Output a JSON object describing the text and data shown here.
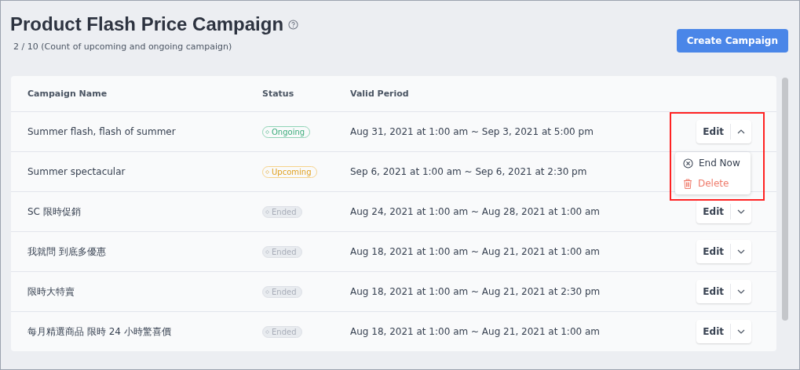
{
  "title": "Product Flash Price Campaign",
  "count_text": "2 / 10 (Count of upcoming and ongoing campaign)",
  "create_button": "Create Campaign",
  "columns": [
    "Campaign Name",
    "Status",
    "Valid Period"
  ],
  "rows": [
    {
      "name": "Summer flash, flash of summer",
      "status": {
        "kind": "ongoing",
        "label": "Ongoing"
      },
      "period": "Aug 31, 2021 at 1:00 am ~ Sep 3, 2021 at 5:00 pm",
      "edit": "Edit",
      "expanded": true
    },
    {
      "name": "Summer spectacular",
      "status": {
        "kind": "upcoming",
        "label": "Upcoming"
      },
      "period": "Sep 6, 2021 at 1:00 am ~ Sep 6, 2021 at 2:30 pm"
    },
    {
      "name": "SC 限時促銷",
      "status": {
        "kind": "ended",
        "label": "Ended"
      },
      "period": "Aug 24, 2021 at 1:00 am ~ Aug 28, 2021 at 1:00 am",
      "edit": "Edit",
      "expanded": false
    },
    {
      "name": "我就問 到底多優惠",
      "status": {
        "kind": "ended",
        "label": "Ended"
      },
      "period": "Aug 18, 2021 at 1:00 am ~ Aug 21, 2021 at 1:00 am",
      "edit": "Edit",
      "expanded": false
    },
    {
      "name": "限時大特賣",
      "status": {
        "kind": "ended",
        "label": "Ended"
      },
      "period": "Aug 18, 2021 at 1:00 am ~ Aug 21, 2021 at 2:30 pm",
      "edit": "Edit",
      "expanded": false
    },
    {
      "name": "每月精選商品 限時 24 小時驚喜價",
      "status": {
        "kind": "ended",
        "label": "Ended"
      },
      "period": "Aug 18, 2021 at 1:00 am ~ Aug 21, 2021 at 1:00 am",
      "edit": "Edit",
      "expanded": false
    }
  ],
  "menu": [
    {
      "kind": "end",
      "label": "End Now"
    },
    {
      "kind": "delete",
      "label": "Delete"
    }
  ]
}
